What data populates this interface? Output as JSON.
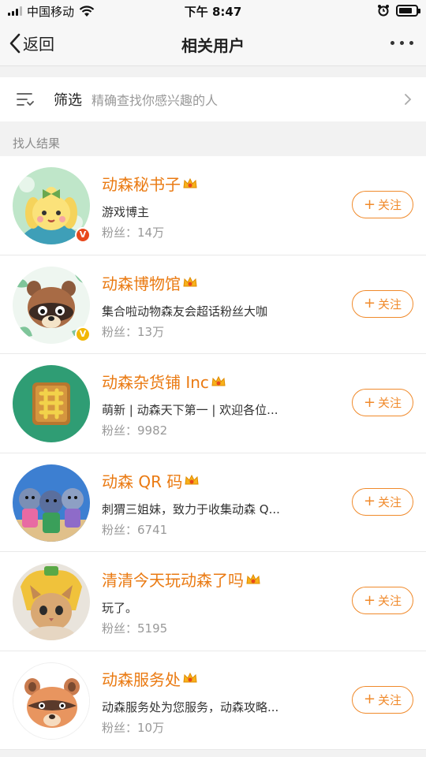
{
  "status_bar": {
    "carrier": "中国移动",
    "time": "下午 8:47",
    "battery_level": 0.8
  },
  "nav": {
    "back_label": "返回",
    "title": "相关用户"
  },
  "filter": {
    "label": "筛选",
    "hint": "精确查找你感兴趣的人"
  },
  "section": {
    "header": "找人结果"
  },
  "follow_label": "关注",
  "users": [
    {
      "name": "动森秘书子",
      "desc": "游戏博主",
      "fans": "粉丝：14万",
      "badge": "red"
    },
    {
      "name": "动森博物馆",
      "desc": "集合啦动物森友会超话粉丝大咖",
      "fans": "粉丝：13万",
      "badge": "gold"
    },
    {
      "name": "动森杂货铺 Inc",
      "desc": "萌新 | 动森天下第一 | 欢迎各位...",
      "fans": "粉丝：9982",
      "badge": ""
    },
    {
      "name": "动森 QR 码",
      "desc": "刺猬三姐妹，致力于收集动森 Q...",
      "fans": "粉丝：6741",
      "badge": ""
    },
    {
      "name": "清清今天玩动森了吗",
      "desc": "玩了。",
      "fans": "粉丝：5195",
      "badge": ""
    },
    {
      "name": "动森服务处",
      "desc": "动森服务处为您服务，动森攻略...",
      "fans": "粉丝：10万",
      "badge": ""
    }
  ],
  "colors": {
    "name": "#ea7a12",
    "follow": "#f08a2b",
    "badge_red": "#e8491d",
    "badge_gold": "#f2b705"
  },
  "icons": [
    "wifi-icon",
    "alarm-icon",
    "battery-icon",
    "back-chevron-icon",
    "more-icon",
    "filter-icon",
    "chevron-right-icon",
    "crown-icon",
    "verified-badge-icon"
  ]
}
